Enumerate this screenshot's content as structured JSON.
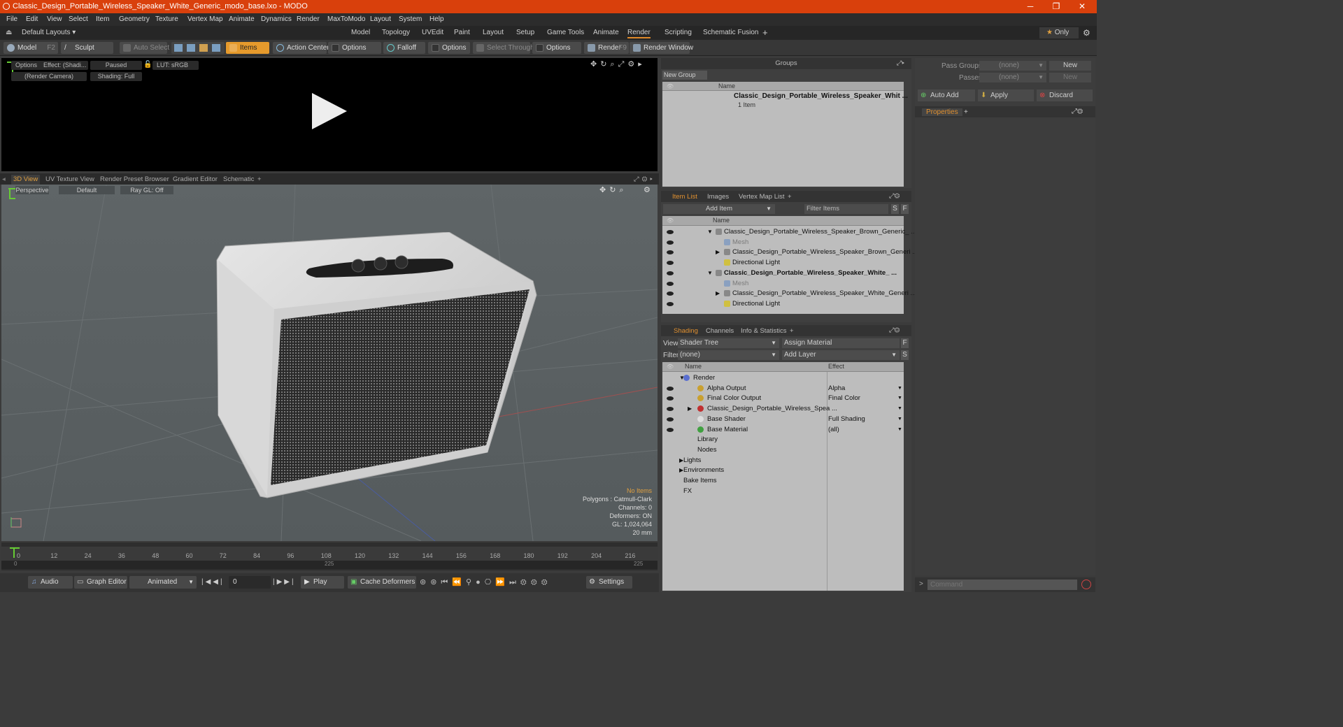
{
  "window": {
    "title": "Classic_Design_Portable_Wireless_Speaker_White_Generic_modo_base.lxo - MODO",
    "min": "─",
    "max": "❐",
    "close": "✕"
  },
  "menu": [
    "File",
    "Edit",
    "View",
    "Select",
    "Item",
    "Geometry",
    "Texture",
    "Vertex Map",
    "Animate",
    "Dynamics",
    "Render",
    "MaxToModo",
    "Layout",
    "System",
    "Help"
  ],
  "layout": {
    "preset": "Default Layouts ▾",
    "tabs": [
      "Model",
      "Topology",
      "UVEdit",
      "Paint",
      "Layout",
      "Setup",
      "Game Tools",
      "Animate",
      "Render",
      "Scripting",
      "Schematic Fusion"
    ],
    "active": "Render",
    "only": "Only",
    "plus": "+"
  },
  "toolbar": {
    "model": "Model",
    "model_key": "F2",
    "sculpt": "Sculpt",
    "auto_select": "Auto Select",
    "items": "Items",
    "action_center": "Action Center",
    "options1": "Options",
    "falloff": "Falloff",
    "options2": "Options",
    "select_through": "Select Through",
    "options3": "Options",
    "render": "Render",
    "render_key": "F9",
    "render_window": "Render Window"
  },
  "preview": {
    "options": "Options",
    "effect": "Effect: (Shadi...",
    "paused": "Paused",
    "lut": "LUT: sRGB",
    "camera": "(Render Camera)",
    "shading": "Shading: Full"
  },
  "viewtabs": [
    "3D View",
    "UV Texture View",
    "Render Preset Browser",
    "Gradient Editor",
    "Schematic",
    "+"
  ],
  "viewport": {
    "perspective": "Perspective",
    "default": "Default",
    "raygl": "Ray GL: Off",
    "no_items": "No Items",
    "polygons": "Polygons : Catmull-Clark",
    "channels": "Channels: 0",
    "deformers": "Deformers: ON",
    "gl": "GL: 1,024,064",
    "mm": "20 mm"
  },
  "timeline": {
    "ticks": [
      "0",
      "12",
      "24",
      "36",
      "48",
      "60",
      "72",
      "84",
      "96",
      "108",
      "120",
      "132",
      "144",
      "156",
      "168",
      "180",
      "192",
      "204",
      "216"
    ],
    "sub_left": "0",
    "sub_mid": "225",
    "sub_right": "225"
  },
  "bottom": {
    "audio": "Audio",
    "graph_editor": "Graph Editor",
    "animated": "Animated",
    "frame": "0",
    "play": "Play",
    "cache": "Cache Deformers",
    "settings": "Settings"
  },
  "groups": {
    "title": "Groups",
    "new_group": "New Group",
    "name_col": "Name",
    "item_name": "Classic_Design_Portable_Wireless_Speaker_Whit ...",
    "item_count": "1 Item"
  },
  "itemlist": {
    "tabs": [
      "Item List",
      "Images",
      "Vertex Map List",
      "+"
    ],
    "add_item": "Add Item",
    "filter": "Filter Items",
    "s": "S",
    "f": "F",
    "name_col": "Name",
    "rows": [
      {
        "label": "Classic_Design_Portable_Wireless_Speaker_Brown_Generic_ ...",
        "indent": 0,
        "bold": false,
        "dim": false,
        "arrow": "▼"
      },
      {
        "label": "Mesh",
        "indent": 1,
        "bold": false,
        "dim": true,
        "arrow": ""
      },
      {
        "label": "Classic_Design_Portable_Wireless_Speaker_Brown_Generi ...",
        "indent": 1,
        "bold": false,
        "dim": false,
        "arrow": "▶"
      },
      {
        "label": "Directional Light",
        "indent": 1,
        "bold": false,
        "dim": false,
        "arrow": ""
      },
      {
        "label": "Classic_Design_Portable_Wireless_Speaker_White_ ...",
        "indent": 0,
        "bold": true,
        "dim": false,
        "arrow": "▼"
      },
      {
        "label": "Mesh",
        "indent": 1,
        "bold": false,
        "dim": true,
        "arrow": ""
      },
      {
        "label": "Classic_Design_Portable_Wireless_Speaker_White_Generi ...",
        "indent": 1,
        "bold": false,
        "dim": false,
        "arrow": "▶"
      },
      {
        "label": "Directional Light",
        "indent": 1,
        "bold": false,
        "dim": false,
        "arrow": ""
      }
    ]
  },
  "shading": {
    "tabs": [
      "Shading",
      "Channels",
      "Info & Statistics",
      "+"
    ],
    "view_label": "View",
    "view_value": "Shader Tree",
    "assign": "Assign Material",
    "filter_label": "Filter",
    "filter_value": "(none)",
    "add_layer": "Add Layer",
    "name_col": "Name",
    "effect_col": "Effect",
    "rows": [
      {
        "label": "Render",
        "effect": "",
        "indent": 0,
        "color": "#5a6fd0"
      },
      {
        "label": "Alpha Output",
        "effect": "Alpha",
        "indent": 1,
        "color": "#c9a030"
      },
      {
        "label": "Final Color Output",
        "effect": "Final Color",
        "indent": 1,
        "color": "#c9a030"
      },
      {
        "label": "Classic_Design_Portable_Wireless_Spea ...",
        "effect": "",
        "indent": 1,
        "color": "#c03030"
      },
      {
        "label": "Base Shader",
        "effect": "Full Shading",
        "indent": 1,
        "color": "#dddddd"
      },
      {
        "label": "Base Material",
        "effect": "(all)",
        "indent": 1,
        "color": "#40a040"
      },
      {
        "label": "Library",
        "effect": "",
        "indent": 1,
        "color": ""
      },
      {
        "label": "Nodes",
        "effect": "",
        "indent": 1,
        "color": ""
      },
      {
        "label": "Lights",
        "effect": "",
        "indent": 0,
        "color": ""
      },
      {
        "label": "Environments",
        "effect": "",
        "indent": 0,
        "color": ""
      },
      {
        "label": "Bake Items",
        "effect": "",
        "indent": 0,
        "color": ""
      },
      {
        "label": "FX",
        "effect": "",
        "indent": 0,
        "color": ""
      }
    ]
  },
  "passes": {
    "pass_groups": "Pass Groups",
    "pass_val": "(none)",
    "new1": "New",
    "passes": "Passes",
    "passes_val": "(none)",
    "new2": "New",
    "auto_add": "Auto Add",
    "apply": "Apply",
    "discard": "Discard",
    "properties": "Properties",
    "plus": "+"
  },
  "command": {
    "placeholder": "Command"
  }
}
